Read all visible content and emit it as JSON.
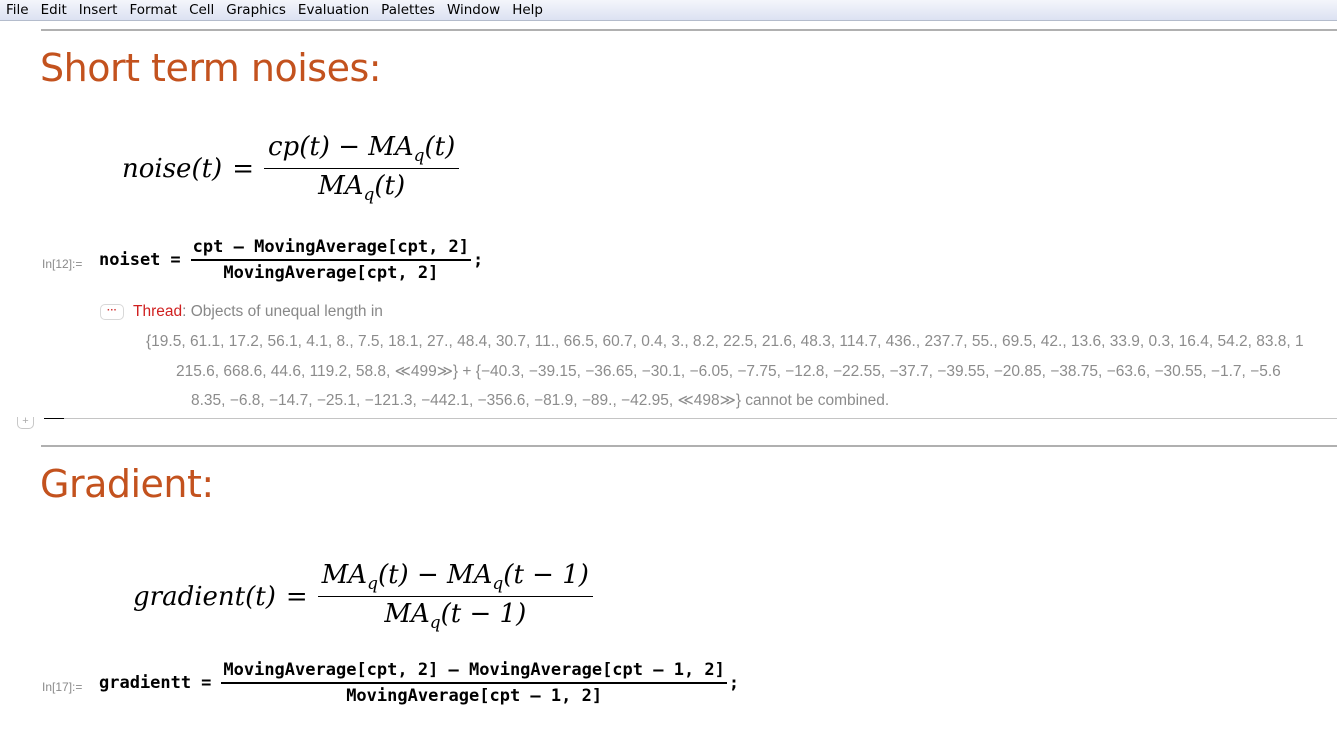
{
  "menubar": {
    "items": [
      "File",
      "Edit",
      "Insert",
      "Format",
      "Cell",
      "Graphics",
      "Evaluation",
      "Palettes",
      "Window",
      "Help"
    ]
  },
  "section1": {
    "title": "Short term noises:",
    "formula": {
      "lhs": "noise(t)",
      "equals": "=",
      "numerator": "cp(t) − MA",
      "numerator_sub": "q",
      "numerator_tail": "(t)",
      "denominator": "MA",
      "denominator_sub": "q",
      "denominator_tail": "(t)"
    },
    "input": {
      "label": "In[12]:=",
      "lhs": "noiset",
      "equals": "=",
      "numerator": "cpt – MovingAverage[cpt, 2]",
      "denominator": "MovingAverage[cpt, 2]",
      "terminator": ";"
    },
    "message": {
      "button": "···",
      "tag": "Thread",
      "text": ": Objects of unequal length in",
      "lines": [
        "{19.5, 61.1, 17.2, 56.1, 4.1, 8., 7.5, 18.1, 27., 48.4, 30.7, 11., 66.5, 60.7, 0.4, 3., 8.2, 22.5, 21.6, 48.3, 114.7, 436., 237.7, 55., 69.5, 42., 13.6, 33.9, 0.3, 16.4, 54.2, 83.8, 1",
        "215.6, 668.6, 44.6, 119.2, 58.8, ≪499≫} + {−40.3, −39.15, −36.65, −30.1, −6.05, −7.75, −12.8, −22.55, −37.7, −39.55, −20.85, −38.75, −63.6, −30.55, −1.7, −5.6",
        "8.35, −6.8, −14.7, −25.1, −121.3, −442.1, −356.6, −81.9, −89., −42.95, ≪498≫} cannot be combined."
      ]
    }
  },
  "section2": {
    "title": "Gradient:",
    "formula": {
      "lhs": "gradient(t)",
      "equals": "=",
      "num_a": "MA",
      "num_a_sub": "q",
      "num_a_tail": "(t) − MA",
      "num_b_sub": "q",
      "num_b_tail": "(t − 1)",
      "den": "MA",
      "den_sub": "q",
      "den_tail": "(t − 1)"
    },
    "input": {
      "label": "In[17]:=",
      "lhs": "gradientt",
      "equals": "=",
      "numerator": "MovingAverage[cpt, 2] – MovingAverage[cpt – 1, 2]",
      "denominator": "MovingAverage[cpt – 1, 2]",
      "terminator": ";"
    }
  },
  "colors": {
    "section_title": "#c3521e",
    "message_tag": "#d02020",
    "message_text": "#8c8c8c"
  }
}
